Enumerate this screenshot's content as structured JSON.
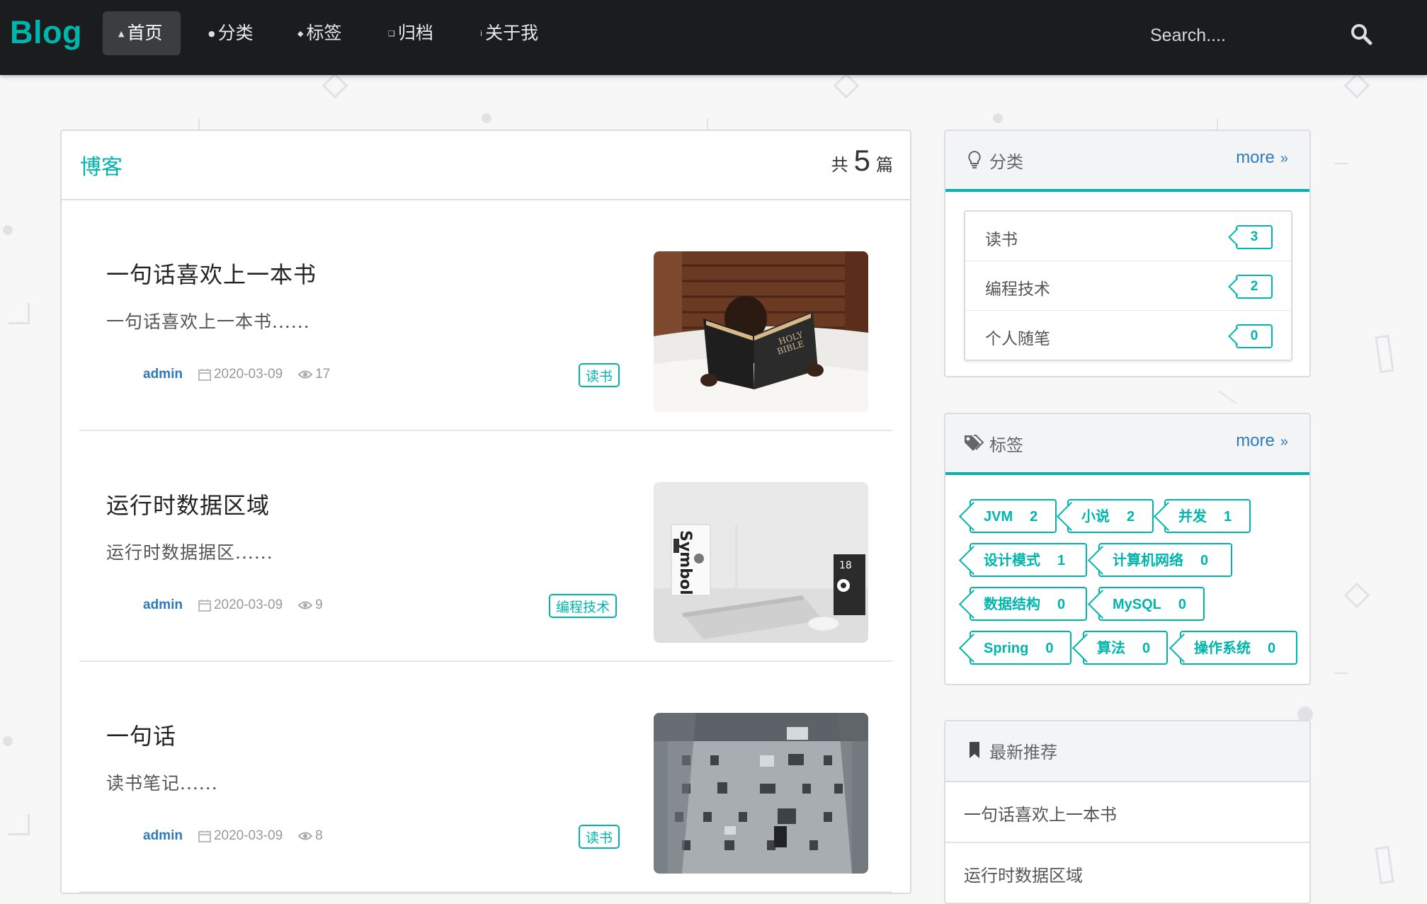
{
  "navbar": {
    "brand": "Blog",
    "items": [
      {
        "label": "首页",
        "icon": "home-icon",
        "active": true
      },
      {
        "label": "分类",
        "icon": "idea-icon",
        "active": false
      },
      {
        "label": "标签",
        "icon": "tag-icon",
        "active": false
      },
      {
        "label": "归档",
        "icon": "clone-icon",
        "active": false
      },
      {
        "label": "关于我",
        "icon": "info-icon",
        "active": false
      }
    ],
    "search": {
      "placeholder": "Search....",
      "icon": "search-icon"
    }
  },
  "blog": {
    "title": "博客",
    "count_prefix": "共",
    "count": "5",
    "count_suffix": "篇",
    "posts": [
      {
        "title": "一句话喜欢上一本书",
        "excerpt": "一句话喜欢上一本书......",
        "author": "admin",
        "date": "2020-03-09",
        "views": "17",
        "category": "读书",
        "image": "child-reading-bible-photo"
      },
      {
        "title": "运行时数据区域",
        "excerpt": "运行时数据据区......",
        "author": "admin",
        "date": "2020-03-09",
        "views": "9",
        "category": "编程技术",
        "image": "laptop-desk-photo"
      },
      {
        "title": "一句话",
        "excerpt": "读书笔记......",
        "author": "admin",
        "date": "2020-03-09",
        "views": "8",
        "category": "读书",
        "image": "old-building-photo"
      }
    ]
  },
  "sidebar": {
    "categories": {
      "title": "分类",
      "more": "more",
      "items": [
        {
          "name": "读书",
          "count": "3"
        },
        {
          "name": "编程技术",
          "count": "2"
        },
        {
          "name": "个人随笔",
          "count": "0"
        }
      ]
    },
    "tags": {
      "title": "标签",
      "more": "more",
      "items": [
        {
          "name": "JVM",
          "count": "2"
        },
        {
          "name": "小说",
          "count": "2"
        },
        {
          "name": "并发",
          "count": "1"
        },
        {
          "name": "设计模式",
          "count": "1"
        },
        {
          "name": "计算机网络",
          "count": "0"
        },
        {
          "name": "数据结构",
          "count": "0"
        },
        {
          "name": "MySQL",
          "count": "0"
        },
        {
          "name": "Spring",
          "count": "0"
        },
        {
          "name": "算法",
          "count": "0"
        },
        {
          "name": "操作系统",
          "count": "0"
        }
      ]
    },
    "recommend": {
      "title": "最新推荐",
      "items": [
        "一句话喜欢上一本书",
        "运行时数据区域"
      ]
    }
  },
  "colors": {
    "accent": "#00b5ad",
    "navbar": "#1b1c1d",
    "link": "#2e7ab8"
  }
}
